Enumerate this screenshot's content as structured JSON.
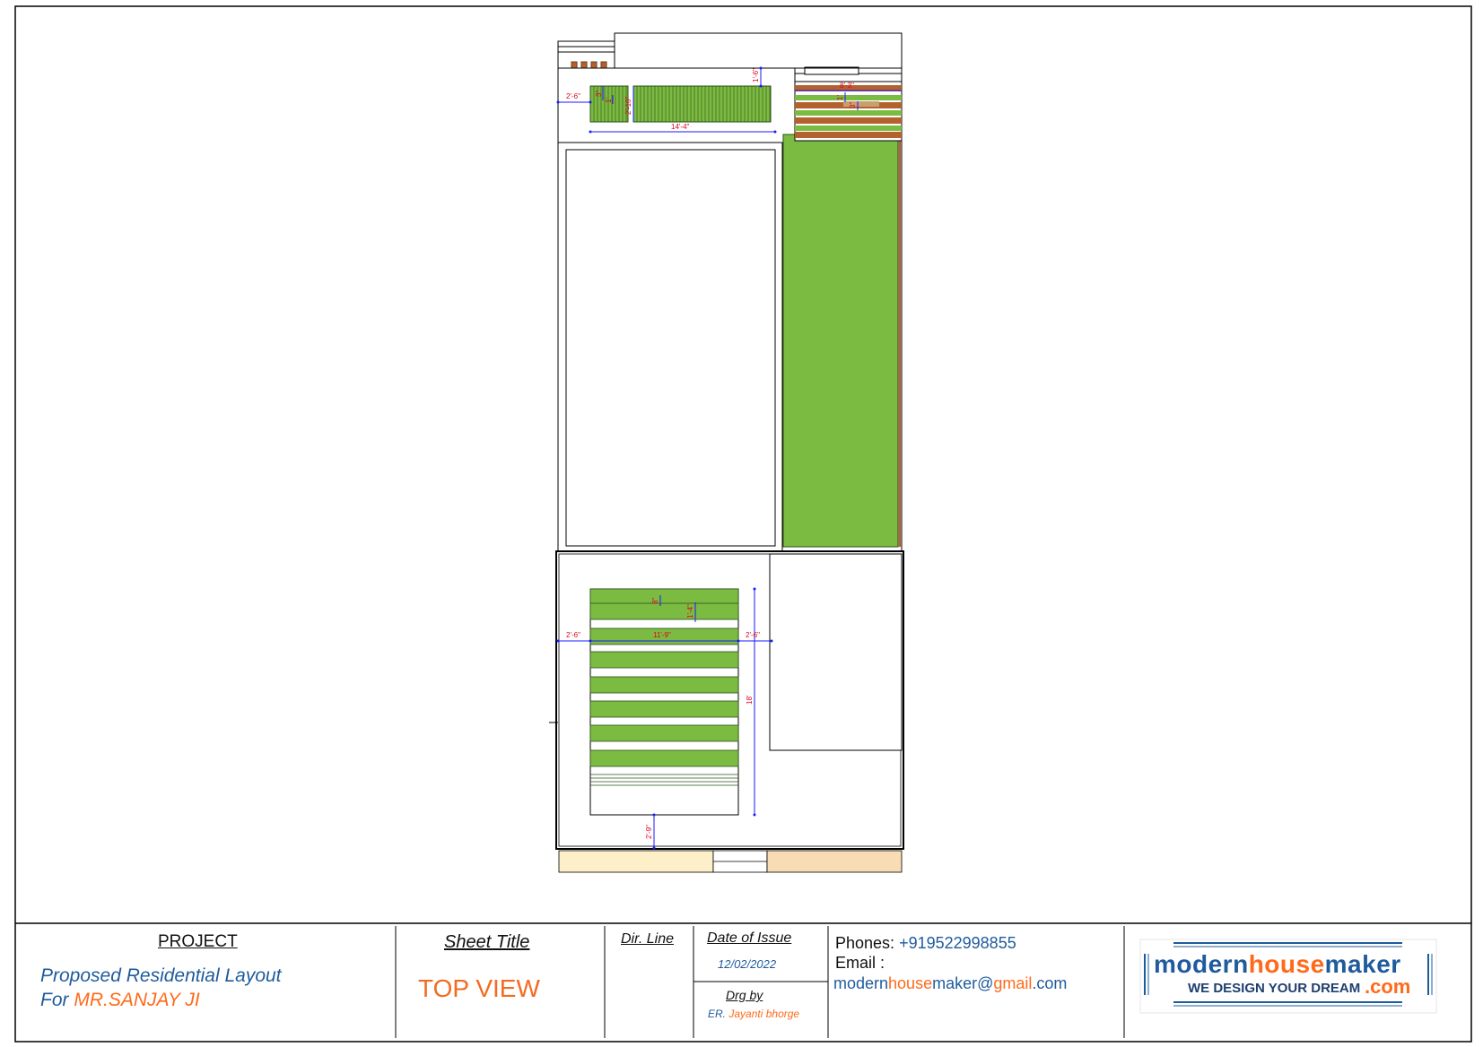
{
  "project": {
    "heading": "PROJECT",
    "line1": "Proposed Residential Layout",
    "line2_prefix": "For",
    "client": "MR.SANJAY  JI"
  },
  "sheet": {
    "heading": "Sheet Title",
    "title": "TOP  VIEW"
  },
  "dir_line": {
    "heading": "Dir. Line"
  },
  "issue": {
    "heading": "Date of Issue",
    "date": "12/02/2022",
    "drg_heading": "Drg by",
    "drg_prefix": "ER.",
    "drg_name": "Jayanti bhorge"
  },
  "contact": {
    "phones_label": "Phones:",
    "phone": "+919522998855",
    "email_label": "Email :",
    "email_part1": "modern",
    "email_part2": "house",
    "email_part3": "maker@",
    "email_part4": "gmail",
    "email_part5": ".com"
  },
  "logo": {
    "part1": "modern",
    "part2": "house",
    "part3": "maker",
    "tagline": "WE DESIGN YOUR DREAM",
    "tld": ".com"
  },
  "dimensions": {
    "top_left_offset": "2'-6\"",
    "top_small_a": "3\"",
    "top_small_b": "1'",
    "top_height": "2'-10\"",
    "top_width": "14'-4\"",
    "top_right_offset": "1'-6\"",
    "right_top_a": "8'-3\"",
    "right_top_b": "1'",
    "right_top_c": "3\"",
    "bottom_left_offset": "2'-6\"",
    "bottom_width": "11'-9\"",
    "bottom_right_offset": "2'-6\"",
    "bottom_small_a": "8\"",
    "bottom_small_b": "1'-4\"",
    "bottom_height": "18'",
    "bottom_offset": "2'-9\""
  },
  "colors": {
    "green": "#7cbb42",
    "brown": "#b5612e",
    "dim_red": "#e0001a",
    "dim_blue": "#1a1aff",
    "sand_left": "#fdf0c8",
    "sand_right": "#f8dcb4",
    "brand_blue": "#1f5b9c",
    "brand_orange": "#ff6a1a"
  }
}
